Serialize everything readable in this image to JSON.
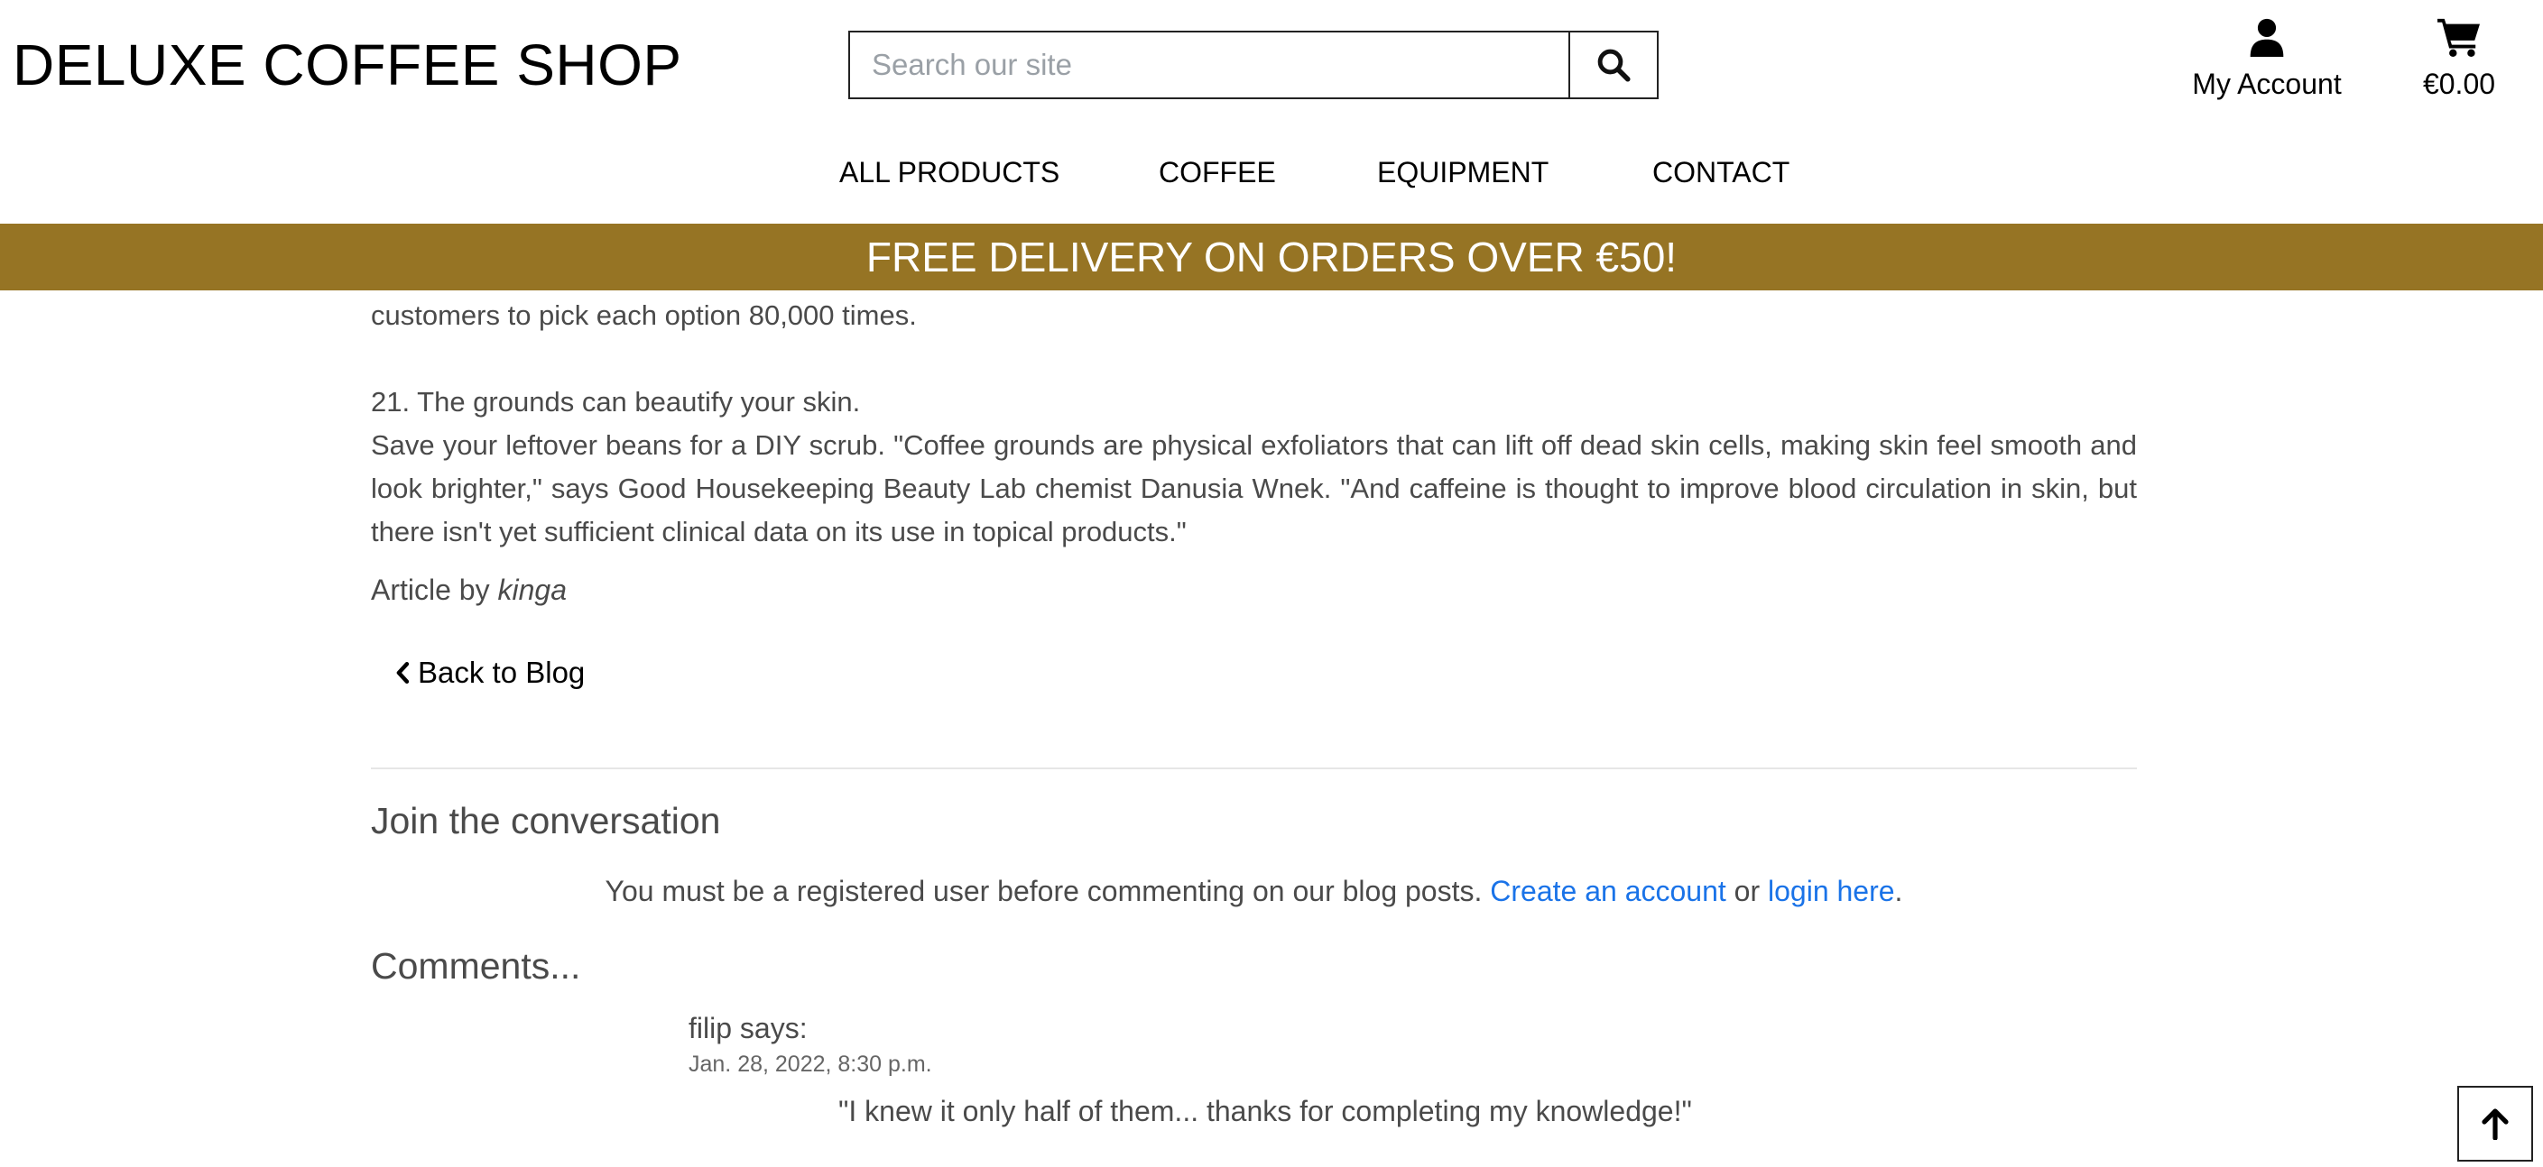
{
  "header": {
    "brand": "DELUXE COFFEE SHOP",
    "search": {
      "placeholder": "Search our site",
      "value": "",
      "button_icon": "search-icon"
    },
    "account": {
      "label": "My Account",
      "icon": "user-icon"
    },
    "cart": {
      "total": "€0.00",
      "icon": "shopping-cart-icon"
    }
  },
  "nav": {
    "items": [
      {
        "label": "ALL PRODUCTS"
      },
      {
        "label": "COFFEE"
      },
      {
        "label": "EQUIPMENT"
      },
      {
        "label": "CONTACT"
      }
    ]
  },
  "banner": {
    "text": "FREE DELIVERY ON ORDERS OVER €50!",
    "color": "#967424"
  },
  "article": {
    "paragraph_continuation": "customers to pick each option 80,000 times.",
    "point_heading": "21. The grounds can beautify your skin.",
    "point_body": "Save your leftover beans for a DIY scrub. \"Coffee grounds are physical exfoliators that can lift off dead skin cells, making skin feel smooth and look brighter,\" says Good Housekeeping Beauty Lab chemist Danusia Wnek. \"And caffeine is thought to improve blood circulation in skin, but there isn't yet sufficient clinical data on its use in topical products.\"",
    "byline_prefix": "Article by",
    "author": "kinga",
    "back_link": "Back to Blog",
    "back_icon": "chevron-left-icon"
  },
  "conversation": {
    "heading": "Join the conversation",
    "message_before": "You must be a registered user before commenting on our blog posts.",
    "create_account_link": "Create an account",
    "connector": "or",
    "login_link": "login here",
    "message_end": ".",
    "link_color": "#1a73e8"
  },
  "comments": {
    "heading": "Comments...",
    "items": [
      {
        "author_line": "filip says:",
        "timestamp": "Jan. 28, 2022, 8:30 p.m.",
        "text": "\"I knew it only half of them... thanks for completing my knowledge!\""
      }
    ]
  },
  "scroll_top": {
    "icon": "arrow-up-icon"
  }
}
